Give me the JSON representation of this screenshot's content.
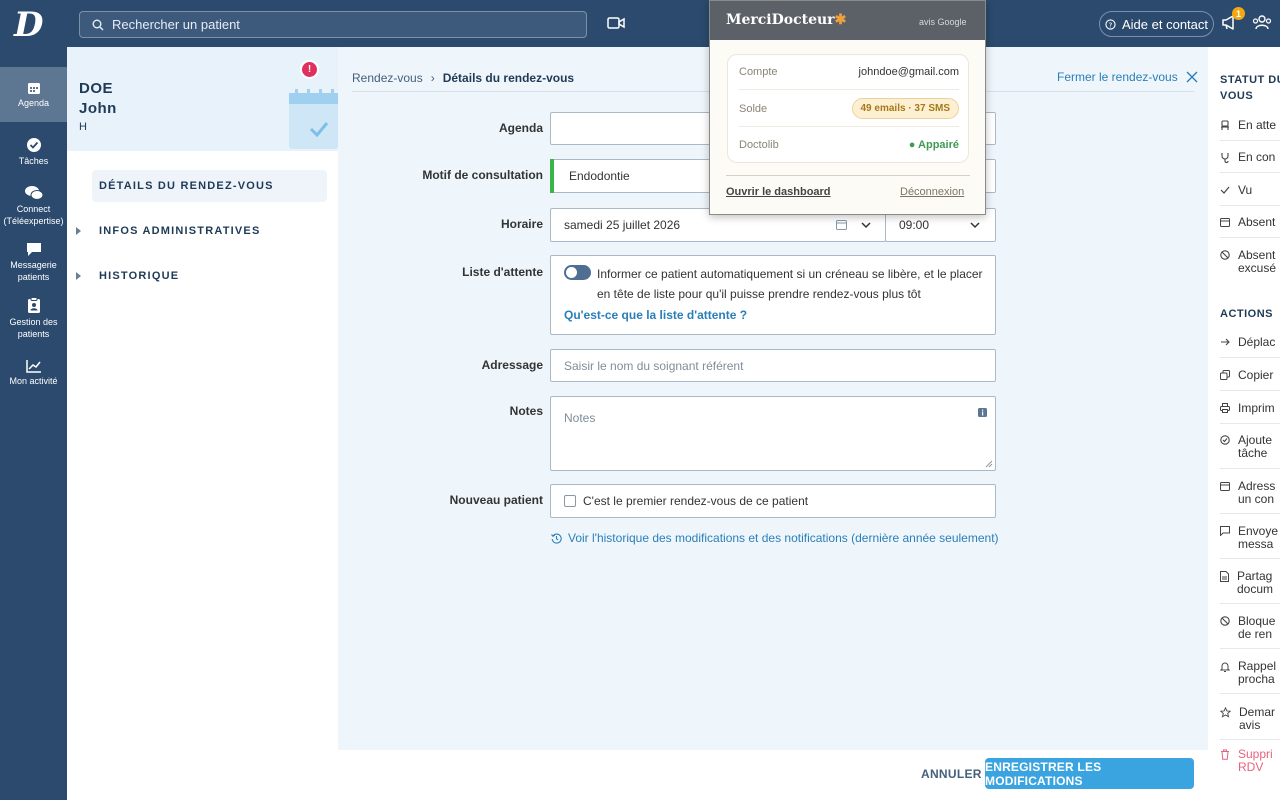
{
  "topbar": {
    "logo": "D",
    "search_placeholder": "Rechercher un patient",
    "help_label": "Aide et contact",
    "notif_count": "1"
  },
  "nav": {
    "items": [
      {
        "label": "Agenda",
        "icon": "calendar-icon",
        "active": true
      },
      {
        "label": "Tâches",
        "icon": "check-circle-icon"
      },
      {
        "label": "Connect (Téléexpertise)",
        "icon": "chat-bubbles-icon"
      },
      {
        "label": "Messagerie patients",
        "icon": "message-icon"
      },
      {
        "label": "Gestion des patients",
        "icon": "clipboard-user-icon"
      },
      {
        "label": "Mon activité",
        "icon": "chart-line-icon"
      }
    ]
  },
  "patient": {
    "last_name": "DOE",
    "first_name": "John",
    "sex": "H",
    "alert": "!",
    "menu": [
      {
        "label": "DÉTAILS DU RENDEZ-VOUS",
        "active": true
      },
      {
        "label": "INFOS ADMINISTRATIVES"
      },
      {
        "label": "HISTORIQUE"
      }
    ]
  },
  "breadcrumb": {
    "root": "Rendez-vous",
    "current": "Détails du rendez-vous",
    "close_label": "Fermer le rendez-vous"
  },
  "form": {
    "agenda_label": "Agenda",
    "agenda_value": "",
    "motif_label": "Motif de consultation",
    "motif_value": "Endodontie",
    "horaire_label": "Horaire",
    "date_value": "samedi 25 juillet 2026",
    "time_value": "09:00",
    "waitlist_label": "Liste d'attente",
    "waitlist_text": "Informer ce patient automatiquement si un créneau se libère, et le placer en tête de liste pour qu'il puisse prendre rendez-vous plus tôt",
    "waitlist_link": "Qu'est-ce que la liste d'attente ?",
    "adressage_label": "Adressage",
    "adressage_placeholder": "Saisir le nom du soignant référent",
    "notes_label": "Notes",
    "notes_placeholder": "Notes",
    "new_patient_label": "Nouveau patient",
    "new_patient_text": "C'est le premier rendez-vous de ce patient",
    "history_link": "Voir l'historique des modifications et des notifications (dernière année seulement)"
  },
  "footer": {
    "cancel": "ANNULER",
    "save": "ENREGISTRER LES MODIFICATIONS"
  },
  "right_panel": {
    "status_title": "STATUT DU VOUS",
    "status": [
      "En atte",
      "En con",
      "Vu",
      "Absent",
      "Absent excusé"
    ],
    "actions_title": "ACTIONS",
    "actions": [
      "Déplac",
      "Copier",
      "Imprim",
      "Ajoute tâche",
      "Adress un con",
      "Envoye messa",
      "Partag docum",
      "Bloque de ren",
      "Rappel procha",
      "Demar avis",
      "Suppri RDV"
    ]
  },
  "popup": {
    "brand": "MerciDocteur",
    "brand_star": "✱",
    "google": "avis Google",
    "account_label": "Compte",
    "account_value": "johndoe@gmail.com",
    "balance_label": "Solde",
    "balance_value": "49 emails · 37 SMS",
    "doctolib_label": "Doctolib",
    "doctolib_value": "● Appairé",
    "dashboard_link": "Ouvrir le dashboard",
    "logout_link": "Déconnexion"
  },
  "colors": {
    "nav_bg": "#2b4a6d",
    "accent": "#3aa4e0",
    "link": "#2a7fb8",
    "green": "#3bb54a",
    "danger": "#e5637f"
  }
}
